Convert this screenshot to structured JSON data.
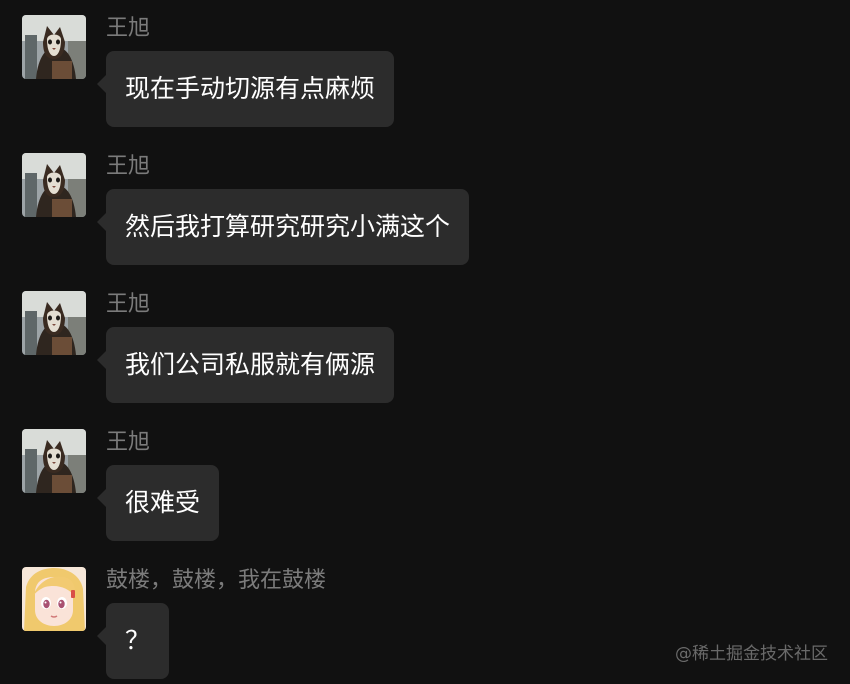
{
  "messages": [
    {
      "sender": "王旭",
      "text": "现在手动切源有点麻烦",
      "avatar": "cat-avatar"
    },
    {
      "sender": "王旭",
      "text": "然后我打算研究研究小满这个",
      "avatar": "cat-avatar"
    },
    {
      "sender": "王旭",
      "text": "我们公司私服就有俩源",
      "avatar": "cat-avatar"
    },
    {
      "sender": "王旭",
      "text": "很难受",
      "avatar": "cat-avatar"
    },
    {
      "sender": "鼓楼，鼓楼，我在鼓楼",
      "text": "？",
      "avatar": "anime-girl-avatar"
    }
  ],
  "watermark": "@稀土掘金技术社区",
  "colors": {
    "background": "#111111",
    "bubble": "#2c2c2c",
    "sender_text": "#7b7b7b",
    "message_text": "#ffffff"
  }
}
